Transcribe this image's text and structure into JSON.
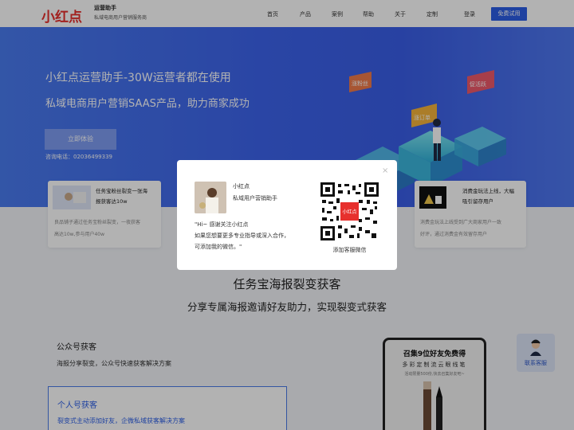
{
  "nav": {
    "logo_text": "小红点",
    "brand_title": "运营助手",
    "brand_subtitle": "私域电商用户营销服务商",
    "items": [
      "首页",
      "产品",
      "案例",
      "帮助",
      "关于",
      "定制",
      "登录"
    ],
    "cta": "免费试用"
  },
  "hero": {
    "title": "小红点运营助手-30W运营者都在使用",
    "subtitle": "私域电商用户营销SAAS产品，助力商家成功",
    "button": "立即体验",
    "phone": "咨询电话：02036499339",
    "tags": [
      "涨粉丝",
      "涨订单",
      "促活跃"
    ]
  },
  "features": [
    {
      "title_line1": "任务宝粉丝裂变一张海",
      "title_line2": "报获客达10w",
      "desc_line1": "良品铺子通过任务宝粉丝裂变，一夜获客",
      "desc_line2": "高达10w,参与用户40w"
    },
    {
      "title_line1": "消费金玩法上线，大幅",
      "title_line2": "吸引留存用户",
      "desc_line1": "消费金玩法上线受到广大商家用户一致",
      "desc_line2": "好评，通过消费金有效留存用户"
    }
  ],
  "section": {
    "title": "任务宝海报裂变获客",
    "subtitle": "分享专属海报邀请好友助力，实现裂变式获客",
    "items": [
      {
        "heading": "公众号获客",
        "desc": "海报分享裂变，公众号快速获客解决方案"
      },
      {
        "heading": "个人号获客",
        "desc": "裂变式主动添加好友，企微私域获客解决方案"
      }
    ]
  },
  "poster": {
    "title": "召集9位好友免费得",
    "subtitle": "多彩定制流云眼线笔",
    "note": "活动限量500份,快去召集好友吧~"
  },
  "service": {
    "label": "联系客服"
  },
  "modal": {
    "name": "小红点",
    "role": "私域用户营销助手",
    "line1": "\"Hi~ 感谢关注小红点",
    "line2": "如果您想要更多专业指导或深入合作，",
    "line3": "可添加我的微信。\"",
    "qr_center": "小红点",
    "qr_caption": "添加客服微信",
    "close": "×"
  }
}
